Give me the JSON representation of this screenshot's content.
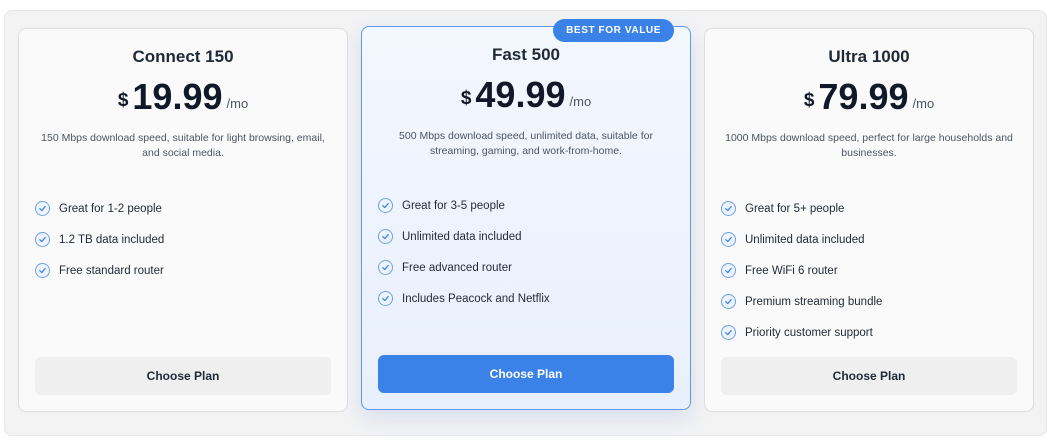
{
  "plans": [
    {
      "name": "Connect 150",
      "currency": "$",
      "price": "19.99",
      "period": "/mo",
      "description": "150 Mbps download speed, suitable for light browsing, email, and social media.",
      "features": [
        "Great for 1-2 people",
        "1.2 TB data included",
        "Free standard router"
      ],
      "button": "Choose Plan"
    },
    {
      "name": "Fast 500",
      "badge": "BEST FOR VALUE",
      "currency": "$",
      "price": "49.99",
      "period": "/mo",
      "description": "500 Mbps download speed, unlimited data, suitable for streaming, gaming, and work-from-home.",
      "features": [
        "Great for 3-5 people",
        "Unlimited data included",
        "Free advanced router",
        "Includes Peacock and Netflix"
      ],
      "button": "Choose Plan"
    },
    {
      "name": "Ultra 1000",
      "currency": "$",
      "price": "79.99",
      "period": "/mo",
      "description": "1000 Mbps download speed, perfect for large households and businesses.",
      "features": [
        "Great for 5+ people",
        "Unlimited data included",
        "Free WiFi 6 router",
        "Premium streaming bundle",
        "Priority customer support"
      ],
      "button": "Choose Plan"
    }
  ],
  "icons": {
    "feature_check": "check-circle-icon"
  },
  "colors": {
    "accent": "#3b82e8",
    "check_border": "#6ea0e6"
  }
}
